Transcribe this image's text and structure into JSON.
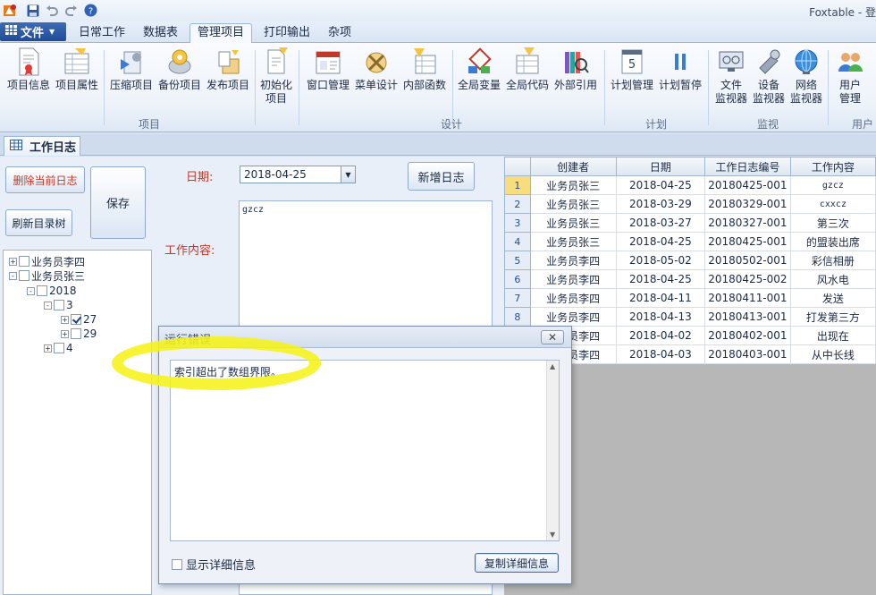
{
  "app": {
    "title": "Foxtable - 登"
  },
  "quick_access": {
    "icons": [
      "app-logo-icon",
      "save-icon",
      "undo-icon",
      "redo-icon",
      "help-icon"
    ]
  },
  "menu": {
    "file_label": "文件",
    "tabs": [
      "日常工作",
      "数据表",
      "管理项目",
      "打印输出",
      "杂项"
    ],
    "active_tab": "管理项目"
  },
  "ribbon": {
    "buttons": [
      {
        "label": "项目信息",
        "icon": "project-info-icon"
      },
      {
        "label": "项目属性",
        "icon": "project-properties-icon"
      },
      {
        "label": "压缩项目",
        "icon": "compress-project-icon"
      },
      {
        "label": "备份项目",
        "icon": "backup-project-icon"
      },
      {
        "label": "发布项目",
        "icon": "publish-project-icon"
      },
      {
        "label": "初始化",
        "label2": "项目",
        "icon": "init-project-icon"
      },
      {
        "label": "窗口管理",
        "icon": "window-manage-icon"
      },
      {
        "label": "菜单设计",
        "icon": "menu-design-icon"
      },
      {
        "label": "内部函数",
        "icon": "internal-function-icon"
      },
      {
        "label": "全局变量",
        "icon": "global-variable-icon"
      },
      {
        "label": "全局代码",
        "icon": "global-code-icon"
      },
      {
        "label": "外部引用",
        "icon": "external-reference-icon"
      },
      {
        "label": "计划管理",
        "icon": "schedule-manage-icon"
      },
      {
        "label": "计划暂停",
        "icon": "schedule-pause-icon"
      },
      {
        "label": "文件",
        "label2": "监视器",
        "icon": "file-monitor-icon"
      },
      {
        "label": "设备",
        "label2": "监视器",
        "icon": "device-monitor-icon"
      },
      {
        "label": "网络",
        "label2": "监视器",
        "icon": "network-monitor-icon"
      },
      {
        "label": "用户",
        "label2": "管理",
        "icon": "user-manage-icon"
      }
    ],
    "groups": [
      "项目",
      "设计",
      "计划",
      "监视",
      "用户"
    ]
  },
  "doc_tab": {
    "label": "工作日志",
    "icon": "grid-icon"
  },
  "left_panel": {
    "delete_button": "删除当前日志",
    "save_button": "保存",
    "refresh_button": "刷新目录树",
    "tree": [
      {
        "label": "业务员李四",
        "expander": "+",
        "checked": false
      },
      {
        "label": "业务员张三",
        "expander": "-",
        "checked": false
      },
      {
        "label": "2018",
        "expander": "-",
        "checked": false
      },
      {
        "label": "3",
        "expander": "-",
        "checked": false
      },
      {
        "label": "27",
        "expander": "+",
        "checked": true
      },
      {
        "label": "29",
        "expander": "+",
        "checked": false
      },
      {
        "label": "4",
        "expander": "+",
        "checked": false
      }
    ]
  },
  "form": {
    "date_label": "日期:",
    "date_value": "2018-04-25",
    "new_button": "新增日志",
    "content_label": "工作内容:",
    "content_value": "gzcz"
  },
  "grid": {
    "columns": [
      "创建者",
      "日期",
      "工作日志编号",
      "工作内容"
    ],
    "rows": [
      [
        "业务员张三",
        "2018-04-25",
        "20180425-001",
        "gzcz"
      ],
      [
        "业务员张三",
        "2018-03-29",
        "20180329-001",
        "cxxcz"
      ],
      [
        "业务员张三",
        "2018-03-27",
        "20180327-001",
        "第三次"
      ],
      [
        "业务员张三",
        "2018-04-25",
        "20180425-001",
        "的盟装出席"
      ],
      [
        "业务员李四",
        "2018-05-02",
        "20180502-001",
        "彩信相册"
      ],
      [
        "业务员李四",
        "2018-04-25",
        "20180425-002",
        "风水电"
      ],
      [
        "业务员李四",
        "2018-04-11",
        "20180411-001",
        "发送"
      ],
      [
        "业务员李四",
        "2018-04-13",
        "20180413-001",
        "打发第三方"
      ],
      [
        "业务员李四",
        "2018-04-02",
        "20180402-001",
        "出现在"
      ],
      [
        "业务员李四",
        "2018-04-03",
        "20180403-001",
        "从中长线"
      ]
    ],
    "selected_row": 0
  },
  "dialog": {
    "title": "运行错误",
    "close": "✕",
    "message": "索引超出了数组界限。",
    "show_details_label": "显示详细信息",
    "copy_button": "复制详细信息"
  },
  "colors": {
    "accent": "#1e4c97",
    "label_red": "#c0392b",
    "highlight": "#f5f218",
    "selected_row": "#f8dd7f"
  }
}
